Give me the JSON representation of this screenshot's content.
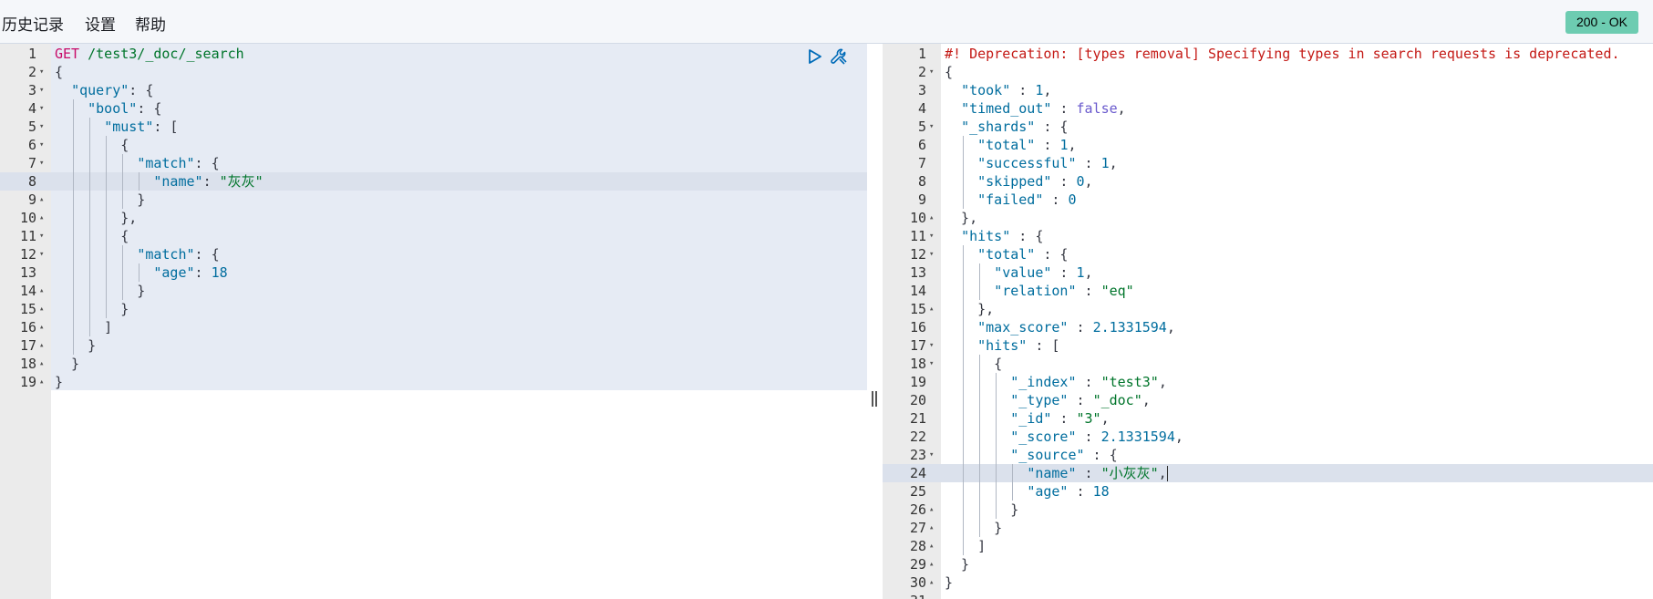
{
  "menu": {
    "history": "历史记录",
    "settings": "设置",
    "help": "帮助"
  },
  "status": "200 - OK",
  "colors": {
    "status_badge": "#6dccb1",
    "active_line": "#dbe1ec",
    "code_bg": "#e6ebf4"
  },
  "request": {
    "lines": [
      {
        "n": "1",
        "fold": "",
        "guides": 0,
        "tokens": [
          [
            "t-method",
            "GET "
          ],
          [
            "t-url",
            "/test3/_doc/_search"
          ]
        ]
      },
      {
        "n": "2",
        "fold": "▾",
        "guides": 0,
        "tokens": [
          [
            "t-punc",
            "{"
          ]
        ]
      },
      {
        "n": "3",
        "fold": "▾",
        "guides": 0,
        "tokens": [
          [
            "t-punc",
            "  "
          ],
          [
            "t-key",
            "\"query\""
          ],
          [
            "t-punc",
            ": {"
          ]
        ]
      },
      {
        "n": "4",
        "fold": "▾",
        "guides": 1,
        "tokens": [
          [
            "t-punc",
            "    "
          ],
          [
            "t-key",
            "\"bool\""
          ],
          [
            "t-punc",
            ": {"
          ]
        ]
      },
      {
        "n": "5",
        "fold": "▾",
        "guides": 2,
        "tokens": [
          [
            "t-punc",
            "      "
          ],
          [
            "t-key",
            "\"must\""
          ],
          [
            "t-punc",
            ": ["
          ]
        ]
      },
      {
        "n": "6",
        "fold": "▾",
        "guides": 3,
        "tokens": [
          [
            "t-punc",
            "        {"
          ]
        ]
      },
      {
        "n": "7",
        "fold": "▾",
        "guides": 4,
        "tokens": [
          [
            "t-punc",
            "          "
          ],
          [
            "t-key",
            "\"match\""
          ],
          [
            "t-punc",
            ": {"
          ]
        ]
      },
      {
        "n": "8",
        "fold": "",
        "guides": 5,
        "active": true,
        "tokens": [
          [
            "t-punc",
            "            "
          ],
          [
            "t-key",
            "\"name\""
          ],
          [
            "t-punc",
            ": "
          ],
          [
            "t-str",
            "\"灰灰\""
          ]
        ]
      },
      {
        "n": "9",
        "fold": "▴",
        "guides": 4,
        "tokens": [
          [
            "t-punc",
            "          }"
          ]
        ]
      },
      {
        "n": "10",
        "fold": "▴",
        "guides": 3,
        "tokens": [
          [
            "t-punc",
            "        },"
          ]
        ]
      },
      {
        "n": "11",
        "fold": "▾",
        "guides": 3,
        "tokens": [
          [
            "t-punc",
            "        {"
          ]
        ]
      },
      {
        "n": "12",
        "fold": "▾",
        "guides": 4,
        "tokens": [
          [
            "t-punc",
            "          "
          ],
          [
            "t-key",
            "\"match\""
          ],
          [
            "t-punc",
            ": {"
          ]
        ]
      },
      {
        "n": "13",
        "fold": "",
        "guides": 5,
        "tokens": [
          [
            "t-punc",
            "            "
          ],
          [
            "t-key",
            "\"age\""
          ],
          [
            "t-punc",
            ": "
          ],
          [
            "t-num",
            "18"
          ]
        ]
      },
      {
        "n": "14",
        "fold": "▴",
        "guides": 4,
        "tokens": [
          [
            "t-punc",
            "          }"
          ]
        ]
      },
      {
        "n": "15",
        "fold": "▴",
        "guides": 3,
        "tokens": [
          [
            "t-punc",
            "        }"
          ]
        ]
      },
      {
        "n": "16",
        "fold": "▴",
        "guides": 2,
        "tokens": [
          [
            "t-punc",
            "      ]"
          ]
        ]
      },
      {
        "n": "17",
        "fold": "▴",
        "guides": 1,
        "tokens": [
          [
            "t-punc",
            "    }"
          ]
        ]
      },
      {
        "n": "18",
        "fold": "▴",
        "guides": 0,
        "tokens": [
          [
            "t-punc",
            "  }"
          ]
        ]
      },
      {
        "n": "19",
        "fold": "▴",
        "guides": 0,
        "tokens": [
          [
            "t-punc",
            "}"
          ]
        ]
      }
    ]
  },
  "response": {
    "lines": [
      {
        "n": "1",
        "fold": "",
        "guides": 0,
        "tokens": [
          [
            "t-comment",
            "#! Deprecation: [types removal] Specifying types in search requests is deprecated."
          ]
        ]
      },
      {
        "n": "2",
        "fold": "▾",
        "guides": 0,
        "tokens": [
          [
            "t-punc",
            "{"
          ]
        ]
      },
      {
        "n": "3",
        "fold": "",
        "guides": 0,
        "tokens": [
          [
            "t-punc",
            "  "
          ],
          [
            "t-key",
            "\"took\""
          ],
          [
            "t-punc",
            " : "
          ],
          [
            "t-num",
            "1"
          ],
          [
            "t-punc",
            ","
          ]
        ]
      },
      {
        "n": "4",
        "fold": "",
        "guides": 0,
        "tokens": [
          [
            "t-punc",
            "  "
          ],
          [
            "t-key",
            "\"timed_out\""
          ],
          [
            "t-punc",
            " : "
          ],
          [
            "t-bool",
            "false"
          ],
          [
            "t-punc",
            ","
          ]
        ]
      },
      {
        "n": "5",
        "fold": "▾",
        "guides": 0,
        "tokens": [
          [
            "t-punc",
            "  "
          ],
          [
            "t-key",
            "\"_shards\""
          ],
          [
            "t-punc",
            " : {"
          ]
        ]
      },
      {
        "n": "6",
        "fold": "",
        "guides": 1,
        "tokens": [
          [
            "t-punc",
            "    "
          ],
          [
            "t-key",
            "\"total\""
          ],
          [
            "t-punc",
            " : "
          ],
          [
            "t-num",
            "1"
          ],
          [
            "t-punc",
            ","
          ]
        ]
      },
      {
        "n": "7",
        "fold": "",
        "guides": 1,
        "tokens": [
          [
            "t-punc",
            "    "
          ],
          [
            "t-key",
            "\"successful\""
          ],
          [
            "t-punc",
            " : "
          ],
          [
            "t-num",
            "1"
          ],
          [
            "t-punc",
            ","
          ]
        ]
      },
      {
        "n": "8",
        "fold": "",
        "guides": 1,
        "tokens": [
          [
            "t-punc",
            "    "
          ],
          [
            "t-key",
            "\"skipped\""
          ],
          [
            "t-punc",
            " : "
          ],
          [
            "t-num",
            "0"
          ],
          [
            "t-punc",
            ","
          ]
        ]
      },
      {
        "n": "9",
        "fold": "",
        "guides": 1,
        "tokens": [
          [
            "t-punc",
            "    "
          ],
          [
            "t-key",
            "\"failed\""
          ],
          [
            "t-punc",
            " : "
          ],
          [
            "t-num",
            "0"
          ]
        ]
      },
      {
        "n": "10",
        "fold": "▴",
        "guides": 0,
        "tokens": [
          [
            "t-punc",
            "  },"
          ]
        ]
      },
      {
        "n": "11",
        "fold": "▾",
        "guides": 0,
        "tokens": [
          [
            "t-punc",
            "  "
          ],
          [
            "t-key",
            "\"hits\""
          ],
          [
            "t-punc",
            " : {"
          ]
        ]
      },
      {
        "n": "12",
        "fold": "▾",
        "guides": 1,
        "tokens": [
          [
            "t-punc",
            "    "
          ],
          [
            "t-key",
            "\"total\""
          ],
          [
            "t-punc",
            " : {"
          ]
        ]
      },
      {
        "n": "13",
        "fold": "",
        "guides": 2,
        "tokens": [
          [
            "t-punc",
            "      "
          ],
          [
            "t-key",
            "\"value\""
          ],
          [
            "t-punc",
            " : "
          ],
          [
            "t-num",
            "1"
          ],
          [
            "t-punc",
            ","
          ]
        ]
      },
      {
        "n": "14",
        "fold": "",
        "guides": 2,
        "tokens": [
          [
            "t-punc",
            "      "
          ],
          [
            "t-key",
            "\"relation\""
          ],
          [
            "t-punc",
            " : "
          ],
          [
            "t-str",
            "\"eq\""
          ]
        ]
      },
      {
        "n": "15",
        "fold": "▴",
        "guides": 1,
        "tokens": [
          [
            "t-punc",
            "    },"
          ]
        ]
      },
      {
        "n": "16",
        "fold": "",
        "guides": 1,
        "tokens": [
          [
            "t-punc",
            "    "
          ],
          [
            "t-key",
            "\"max_score\""
          ],
          [
            "t-punc",
            " : "
          ],
          [
            "t-num",
            "2.1331594"
          ],
          [
            "t-punc",
            ","
          ]
        ]
      },
      {
        "n": "17",
        "fold": "▾",
        "guides": 1,
        "tokens": [
          [
            "t-punc",
            "    "
          ],
          [
            "t-key",
            "\"hits\""
          ],
          [
            "t-punc",
            " : ["
          ]
        ]
      },
      {
        "n": "18",
        "fold": "▾",
        "guides": 2,
        "tokens": [
          [
            "t-punc",
            "      {"
          ]
        ]
      },
      {
        "n": "19",
        "fold": "",
        "guides": 3,
        "tokens": [
          [
            "t-punc",
            "        "
          ],
          [
            "t-key",
            "\"_index\""
          ],
          [
            "t-punc",
            " : "
          ],
          [
            "t-str",
            "\"test3\""
          ],
          [
            "t-punc",
            ","
          ]
        ]
      },
      {
        "n": "20",
        "fold": "",
        "guides": 3,
        "tokens": [
          [
            "t-punc",
            "        "
          ],
          [
            "t-key",
            "\"_type\""
          ],
          [
            "t-punc",
            " : "
          ],
          [
            "t-str",
            "\"_doc\""
          ],
          [
            "t-punc",
            ","
          ]
        ]
      },
      {
        "n": "21",
        "fold": "",
        "guides": 3,
        "tokens": [
          [
            "t-punc",
            "        "
          ],
          [
            "t-key",
            "\"_id\""
          ],
          [
            "t-punc",
            " : "
          ],
          [
            "t-str",
            "\"3\""
          ],
          [
            "t-punc",
            ","
          ]
        ]
      },
      {
        "n": "22",
        "fold": "",
        "guides": 3,
        "tokens": [
          [
            "t-punc",
            "        "
          ],
          [
            "t-key",
            "\"_score\""
          ],
          [
            "t-punc",
            " : "
          ],
          [
            "t-num",
            "2.1331594"
          ],
          [
            "t-punc",
            ","
          ]
        ]
      },
      {
        "n": "23",
        "fold": "▾",
        "guides": 3,
        "tokens": [
          [
            "t-punc",
            "        "
          ],
          [
            "t-key",
            "\"_source\""
          ],
          [
            "t-punc",
            " : {"
          ]
        ]
      },
      {
        "n": "24",
        "fold": "",
        "guides": 4,
        "active": true,
        "cursor": true,
        "tokens": [
          [
            "t-punc",
            "          "
          ],
          [
            "t-key",
            "\"name\""
          ],
          [
            "t-punc",
            " : "
          ],
          [
            "t-str",
            "\"小灰灰\""
          ],
          [
            "t-punc",
            ","
          ]
        ]
      },
      {
        "n": "25",
        "fold": "",
        "guides": 4,
        "tokens": [
          [
            "t-punc",
            "          "
          ],
          [
            "t-key",
            "\"age\""
          ],
          [
            "t-punc",
            " : "
          ],
          [
            "t-num",
            "18"
          ]
        ]
      },
      {
        "n": "26",
        "fold": "▴",
        "guides": 3,
        "tokens": [
          [
            "t-punc",
            "        }"
          ]
        ]
      },
      {
        "n": "27",
        "fold": "▴",
        "guides": 2,
        "tokens": [
          [
            "t-punc",
            "      }"
          ]
        ]
      },
      {
        "n": "28",
        "fold": "▴",
        "guides": 1,
        "tokens": [
          [
            "t-punc",
            "    ]"
          ]
        ]
      },
      {
        "n": "29",
        "fold": "▴",
        "guides": 0,
        "tokens": [
          [
            "t-punc",
            "  }"
          ]
        ]
      },
      {
        "n": "30",
        "fold": "▴",
        "guides": 0,
        "tokens": [
          [
            "t-punc",
            "}"
          ]
        ]
      },
      {
        "n": "31",
        "fold": "",
        "guides": 0,
        "tokens": []
      }
    ]
  }
}
